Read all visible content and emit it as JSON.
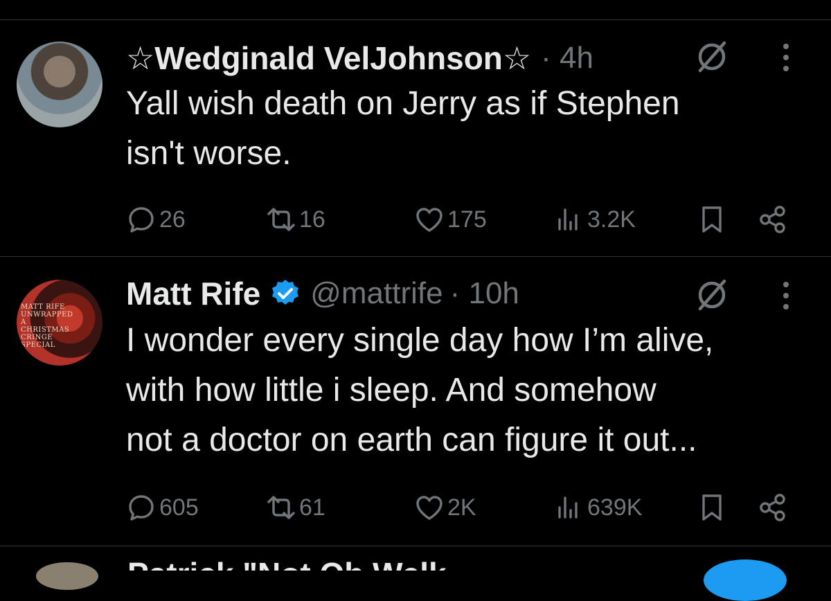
{
  "tweets": [
    {
      "name": "☆Wedginald VelJohnson☆",
      "handle": "",
      "time": "· 4h",
      "text": [
        "Yall wish death on Jerry as if Stephen",
        "isn't worse."
      ],
      "replies": "26",
      "reposts": "16",
      "likes": "175",
      "views": "3.2K"
    },
    {
      "name": "Matt Rife",
      "handle": "@mattrife",
      "time": "· 10h",
      "avatar_text": "MATT RIFE\nUNWRAPPED\nA CHRISTMAS\nCRINGE SPECIAL",
      "text": [
        "I wonder every single day how I’m alive,",
        "with how little i sleep. And somehow",
        "not a doctor on earth can figure it out..."
      ],
      "replies": "605",
      "reposts": "61",
      "likes": "2K",
      "views": "639K"
    }
  ],
  "next_tweet": {
    "name": "Patrick \"Not Oh Welk..."
  },
  "colors": {
    "background": "#000000",
    "text": "#e7e9ea",
    "muted": "#71767b",
    "divider": "#2f3336",
    "verified": "#1d9bf0"
  },
  "icons": [
    "grok-slash-icon",
    "more-icon",
    "reply-icon",
    "repost-icon",
    "like-icon",
    "views-icon",
    "bookmark-icon",
    "share-icon",
    "verified-badge-icon"
  ]
}
